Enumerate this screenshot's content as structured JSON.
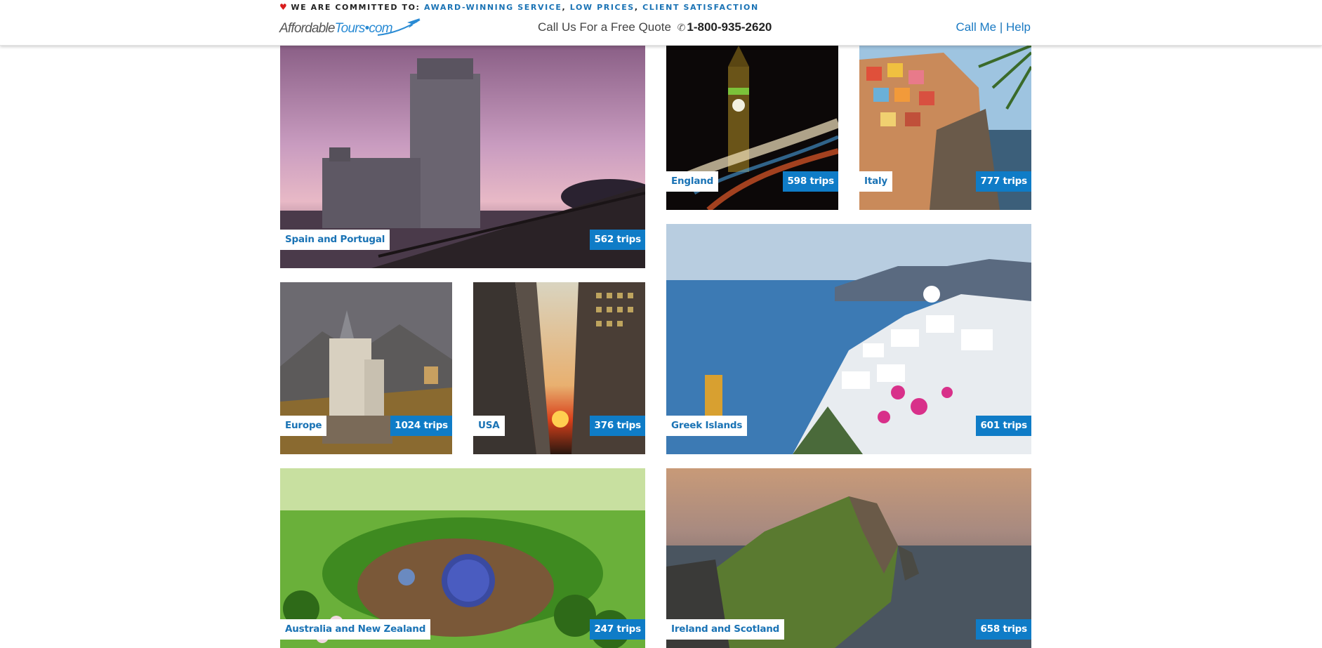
{
  "banner": {
    "prefix": "WE ARE COMMITTED TO:",
    "items": [
      "AWARD-WINNING SERVICE",
      "LOW PRICES",
      "CLIENT SATISFACTION"
    ],
    "separator": ","
  },
  "logo": {
    "part1": "Affordable",
    "part2": "Tours",
    "part3": "com"
  },
  "quote": {
    "text": "Call Us For a Free Quote",
    "phone": "1-800-935-2620"
  },
  "header_links": {
    "call_me": "Call Me",
    "divider": "|",
    "help": "Help"
  },
  "destinations": [
    {
      "name": "Spain and Portugal",
      "trips": "562 trips"
    },
    {
      "name": "England",
      "trips": "598 trips"
    },
    {
      "name": "Italy",
      "trips": "777 trips"
    },
    {
      "name": "Europe",
      "trips": "1024 trips"
    },
    {
      "name": "USA",
      "trips": "376 trips"
    },
    {
      "name": "Greek Islands",
      "trips": "601 trips"
    },
    {
      "name": "Australia and New Zealand",
      "trips": "247 trips"
    },
    {
      "name": "Ireland and Scotland",
      "trips": "658 trips"
    }
  ],
  "colors": {
    "accent": "#0f7cc7",
    "link": "#1a73b5",
    "heart": "#d91d1d"
  }
}
